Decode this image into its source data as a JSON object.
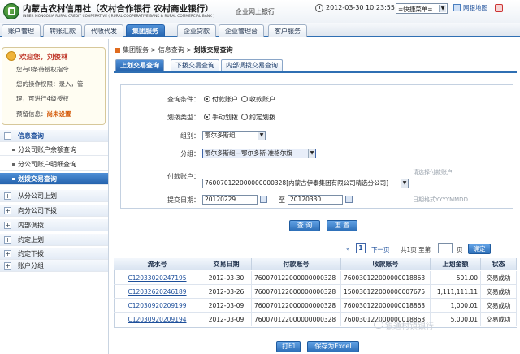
{
  "header": {
    "brand_cn": "内蒙古农村信用社（农村合作银行 农村商业银行）",
    "brand_en": "INNER MONGOLIA RURAL CREDIT COOPERATIVE ( RURAL COOPERATIVE BANK & RURAL COMMERCIAL BANK )",
    "subtitle": "企业网上银行",
    "datetime": "2012-03-30 10:23:55",
    "quick_menu": "=快捷菜单=",
    "sitemap": "网银地图"
  },
  "nav": {
    "tabs": [
      {
        "label": "账户管理"
      },
      {
        "label": "转账汇款"
      },
      {
        "label": "代收代发"
      },
      {
        "label": "集团服务"
      },
      {
        "label": "企业贷款"
      },
      {
        "label": "企业管理台"
      },
      {
        "label": "客户服务"
      }
    ],
    "active": "集团服务"
  },
  "welcome": {
    "greeting": "欢迎您，",
    "user": "刘俊林",
    "line1": "您有0条待授权指令",
    "line2": "您的操作权限：录入，管",
    "line3": "理，可进行4级授权",
    "line4_label": "预留信息：",
    "line4_value": "尚未设置"
  },
  "sidebar": {
    "groups": [
      {
        "label": "信息查询",
        "toggle": "−"
      },
      {
        "label": "从分公司上划",
        "toggle": "+"
      },
      {
        "label": "向分公司下拨",
        "toggle": "+"
      },
      {
        "label": "内部调拨",
        "toggle": "+"
      },
      {
        "label": "约定上划",
        "toggle": "+"
      },
      {
        "label": "约定下拨",
        "toggle": "+"
      },
      {
        "label": "账户分组",
        "toggle": "+"
      }
    ],
    "subitems": [
      {
        "label": "分公司账户余额查询"
      },
      {
        "label": "分公司账户明细查询"
      },
      {
        "label": "划拨交易查询"
      }
    ]
  },
  "breadcrumb": {
    "path": "集团服务 > 信息查询 > ",
    "current": "划拨交易查询"
  },
  "subtabs": [
    {
      "label": "上划交易查询"
    },
    {
      "label": "下拨交易查询"
    },
    {
      "label": "内部调拨交易查询"
    }
  ],
  "form": {
    "query_condition_label": "查询条件：",
    "query_options": [
      "付款账户",
      "收款账户"
    ],
    "transfer_type_label": "划拨类型：",
    "transfer_options": [
      "手动划拨",
      "约定划拨"
    ],
    "group_label": "组别：",
    "group_value": "鄂尔多斯组",
    "subgroup_label": "分组：",
    "subgroup_value": "鄂尔多斯组—鄂尔多斯-准格尔旗",
    "payer_label": "付款账户：",
    "payer_value": "760070122000000000328[内蒙古伊泰集团有限公司精选分公司]",
    "payer_hint": "请选择付款账户",
    "date_label": "提交日期：",
    "date_from": "20120229",
    "date_to_label": "至",
    "date_to": "20120330",
    "date_hint": "日期格式YYYYMMDD",
    "query_button": "查 询",
    "reset_button": "重 置"
  },
  "pager": {
    "first": "«",
    "current": "1",
    "next": "下一页",
    "summary": "共1页 至第",
    "page_input": "",
    "unit": "页",
    "go": "确定"
  },
  "table": {
    "headers": [
      "流水号",
      "交易日期",
      "付款账号",
      "收款账号",
      "上划金额",
      "状态"
    ],
    "rows": [
      [
        "C12033020247195",
        "2012-03-30",
        "760070122000000000328",
        "760030122000000018863",
        "501.00",
        "交易成功"
      ],
      [
        "C12032620246189",
        "2012-03-26",
        "760070122000000000328",
        "150030122000000007675",
        "1,111,111.11",
        "交易成功"
      ],
      [
        "C12030920209199",
        "2012-03-09",
        "760070122000000000328",
        "760030122000000018863",
        "1,000.01",
        "交易成功"
      ],
      [
        "C12030920209194",
        "2012-03-09",
        "760070122000000000328",
        "760030122000000018863",
        "5,000.01",
        "交易成功"
      ]
    ]
  },
  "footer": {
    "print_button": "打印",
    "excel_button": "保存为Excel"
  },
  "watermark": "银通村镇银行"
}
